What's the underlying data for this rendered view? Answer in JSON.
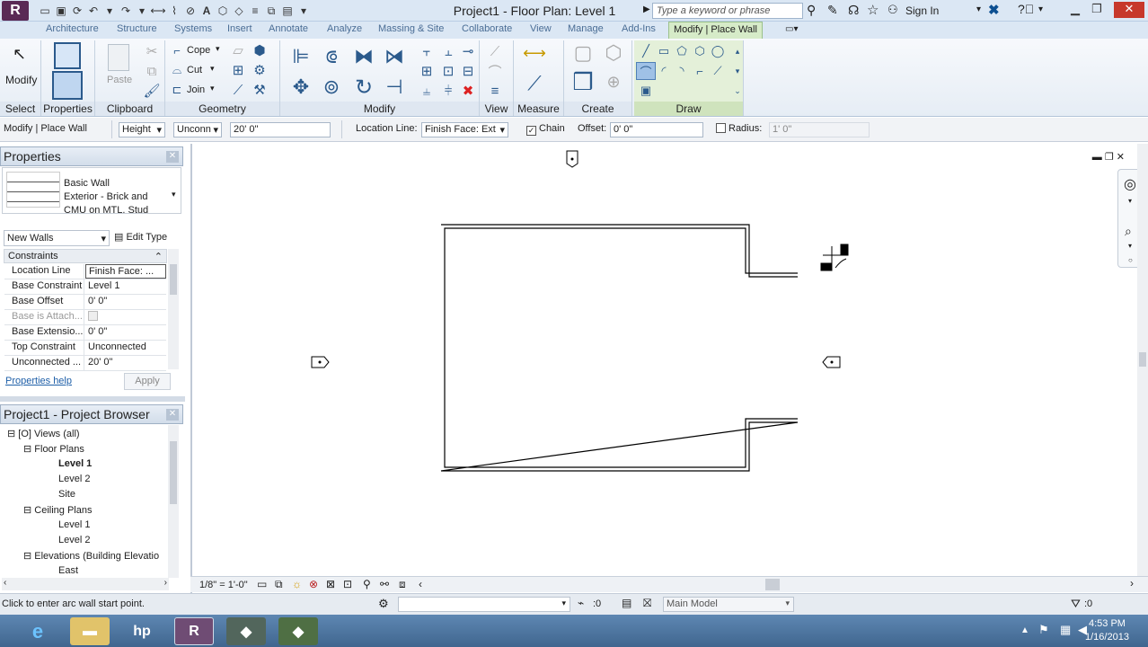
{
  "app": {
    "title": "Project1 - Floor Plan: Level 1",
    "logo": "R",
    "search_placeholder": "Type a keyword or phrase",
    "sign_in": "Sign In"
  },
  "tabs": [
    "Architecture",
    "Structure",
    "Systems",
    "Insert",
    "Annotate",
    "Analyze",
    "Massing & Site",
    "Collaborate",
    "View",
    "Manage",
    "Add-Ins"
  ],
  "active_tab": "Modify | Place Wall",
  "ribbon": {
    "panels": {
      "select": "Select",
      "properties": "Properties",
      "clipboard": "Clipboard",
      "geometry": "Geometry",
      "modify": "Modify",
      "view": "View",
      "measure": "Measure",
      "create": "Create",
      "draw": "Draw"
    },
    "modify_btn": "Modify",
    "paste_btn": "Paste",
    "cope": "Cope",
    "cut": "Cut",
    "join": "Join"
  },
  "options": {
    "context": "Modify | Place Wall",
    "height_mode": "Height",
    "top_constraint": "Unconn",
    "height_value": "20'  0\"",
    "location_line_label": "Location Line:",
    "location_line_value": "Finish Face: Ext",
    "chain_label": "Chain",
    "offset_label": "Offset:",
    "offset_value": "0'  0\"",
    "radius_label": "Radius:",
    "radius_value": "1'  0\""
  },
  "properties": {
    "title": "Properties",
    "type_family": "Basic Wall",
    "type_name_1": "Exterior - Brick and",
    "type_name_2": "CMU on MTL. Stud",
    "filter": "New Walls",
    "edit_type": "Edit Type",
    "section": "Constraints",
    "rows": [
      {
        "k": "Location Line",
        "v": "Finish Face: ..."
      },
      {
        "k": "Base Constraint",
        "v": "Level 1"
      },
      {
        "k": "Base Offset",
        "v": "0'  0\""
      },
      {
        "k": "Base is Attach...",
        "v": ""
      },
      {
        "k": "Base Extensio...",
        "v": "0'  0\""
      },
      {
        "k": "Top Constraint",
        "v": "Unconnected"
      },
      {
        "k": "Unconnected ...",
        "v": "20'  0\""
      }
    ],
    "help": "Properties help",
    "apply": "Apply"
  },
  "browser": {
    "title": "Project1 - Project Browser",
    "items": [
      {
        "t": "Views (all)",
        "lvl": 0,
        "bold": false
      },
      {
        "t": "Floor Plans",
        "lvl": 1,
        "bold": false
      },
      {
        "t": "Level 1",
        "lvl": 2,
        "bold": true
      },
      {
        "t": "Level 2",
        "lvl": 2,
        "bold": false
      },
      {
        "t": "Site",
        "lvl": 2,
        "bold": false
      },
      {
        "t": "Ceiling Plans",
        "lvl": 1,
        "bold": false
      },
      {
        "t": "Level 1",
        "lvl": 2,
        "bold": false
      },
      {
        "t": "Level 2",
        "lvl": 2,
        "bold": false
      },
      {
        "t": "Elevations (Building Elevatio",
        "lvl": 1,
        "bold": false
      },
      {
        "t": "East",
        "lvl": 2,
        "bold": false
      }
    ]
  },
  "viewbar": {
    "scale": "1/8\" = 1'-0\""
  },
  "status": {
    "message": "Click to enter arc wall start point.",
    "count": ":0",
    "model": "Main Model",
    "filter_count": ":0"
  },
  "clock": {
    "time": "4:53 PM",
    "date": "1/16/2013"
  }
}
